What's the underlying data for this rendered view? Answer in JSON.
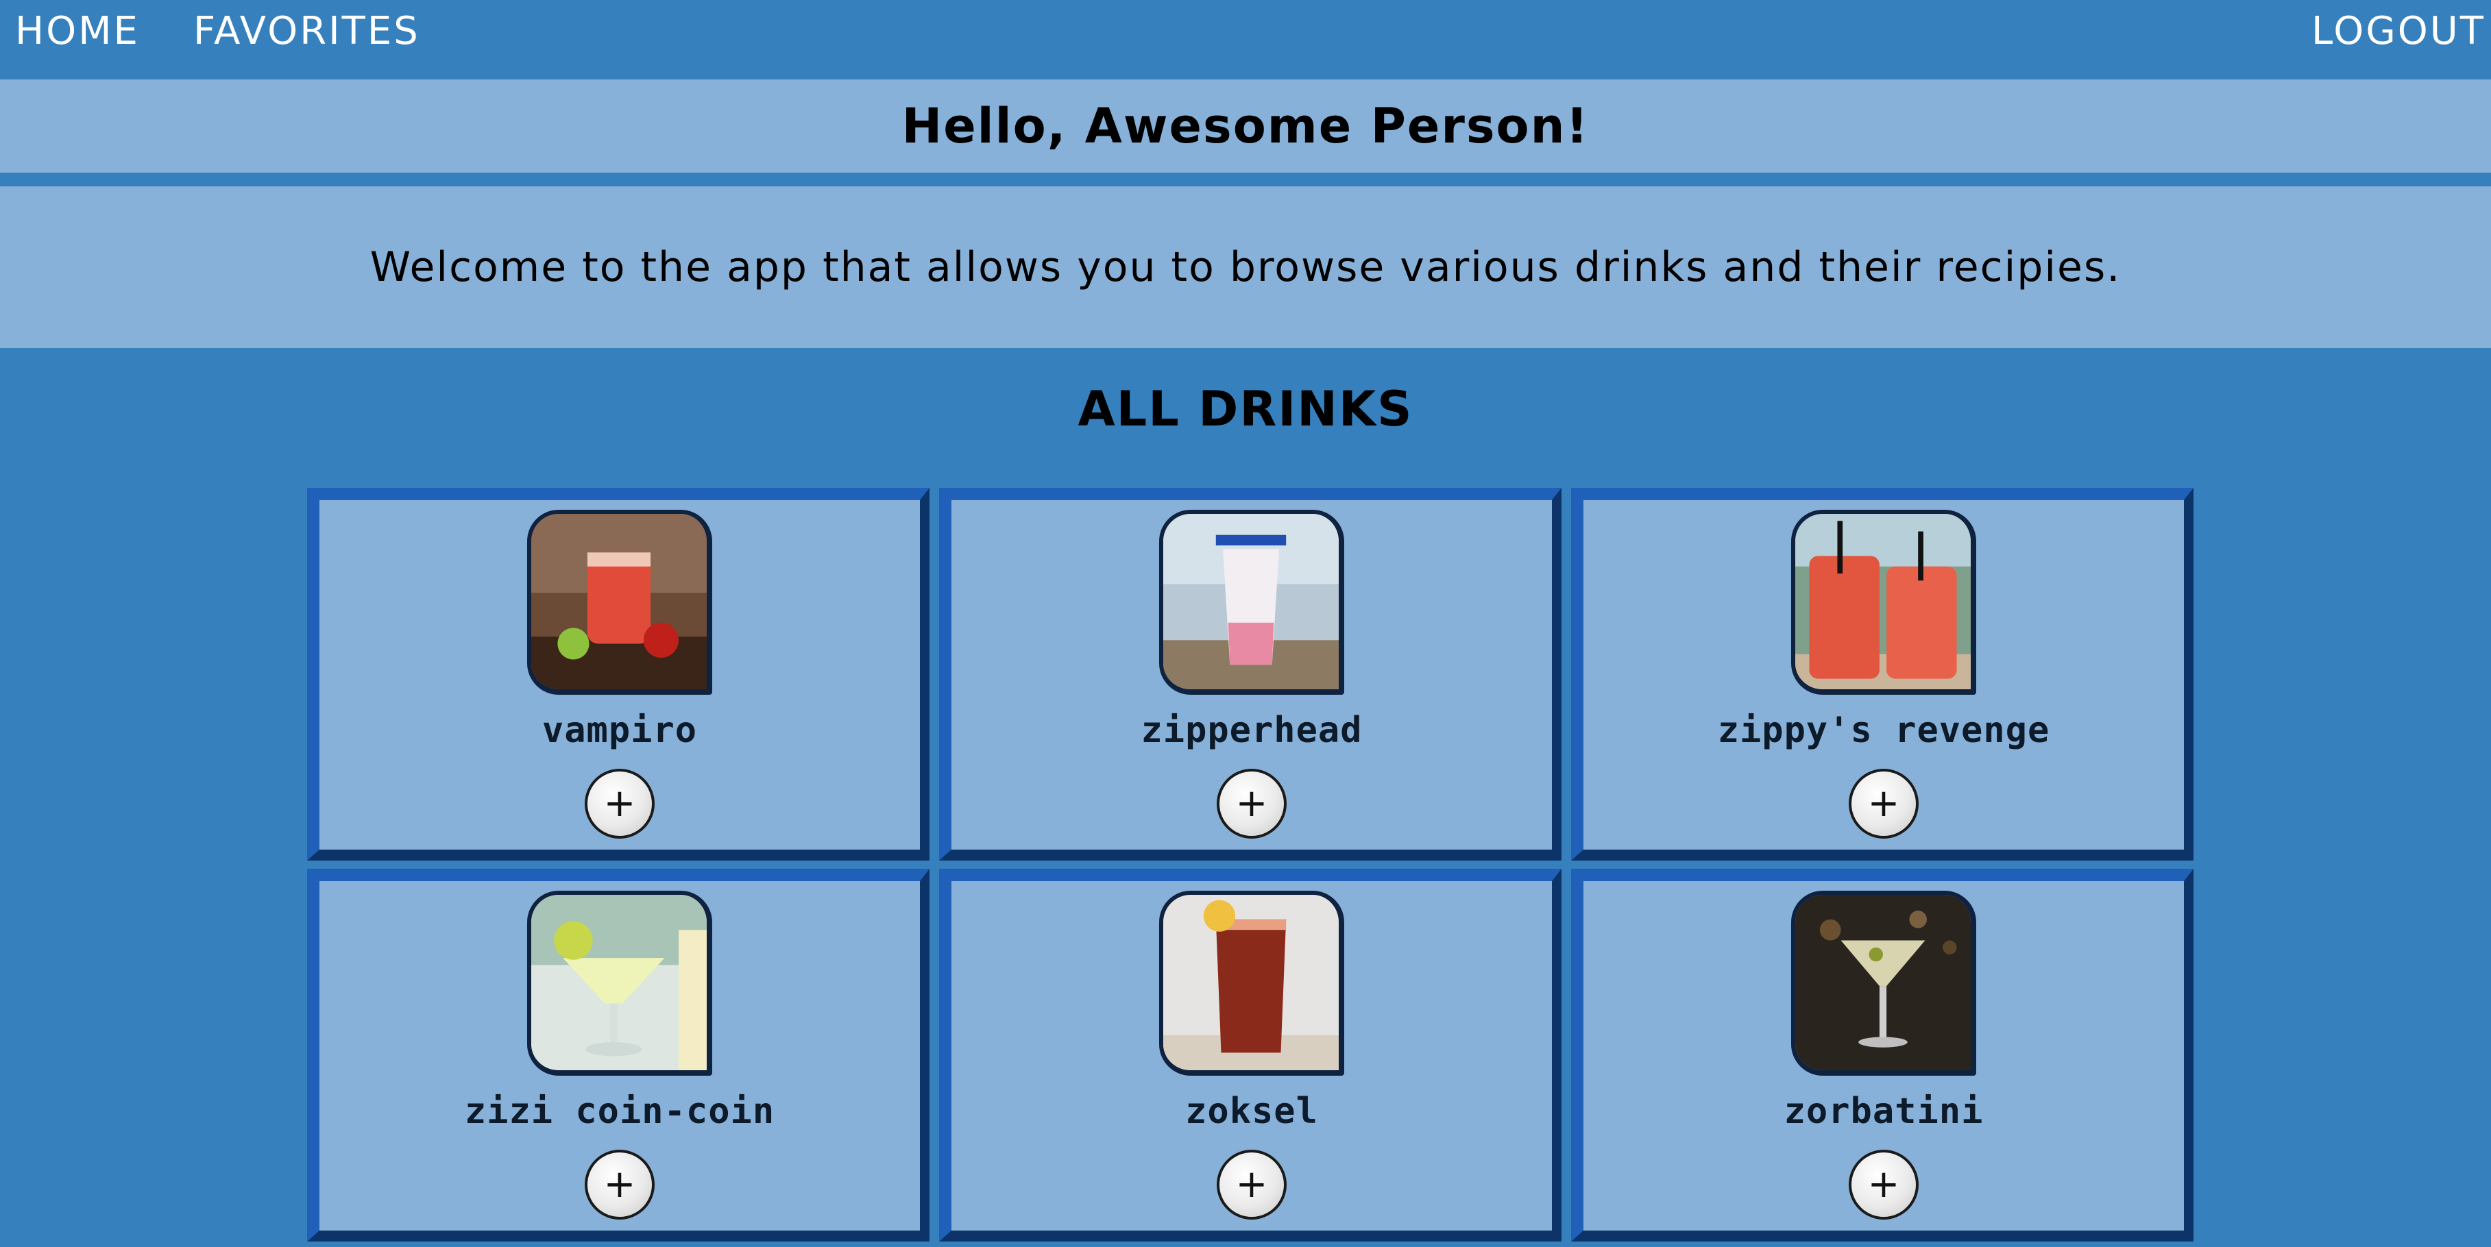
{
  "nav": {
    "home_label": "HOME",
    "favorites_label": "FAVORITES",
    "logout_label": "LOGOUT"
  },
  "greeting": "Hello, Awesome Person!",
  "welcome_text": "Welcome to the app that allows you to browse various drinks and their recipies.",
  "section_title": "ALL DRINKS",
  "add_button_symbol": "+",
  "drinks": [
    {
      "name": "vampiro",
      "image_icon": "red-drink-jar-icon"
    },
    {
      "name": "zipperhead",
      "image_icon": "pink-iced-drink-icon"
    },
    {
      "name": "zippy's revenge",
      "image_icon": "twin-red-drinks-icon"
    },
    {
      "name": "zizi coin-coin",
      "image_icon": "margarita-glass-icon"
    },
    {
      "name": "zoksel",
      "image_icon": "dark-red-highball-icon"
    },
    {
      "name": "zorbatini",
      "image_icon": "martini-glass-icon"
    }
  ],
  "colors": {
    "page_bg": "#3680bd",
    "banner_bg": "#87b1d8",
    "card_bg": "#87b1d8",
    "card_border_light": "#2060b8",
    "card_border_dark": "#0d3468"
  }
}
